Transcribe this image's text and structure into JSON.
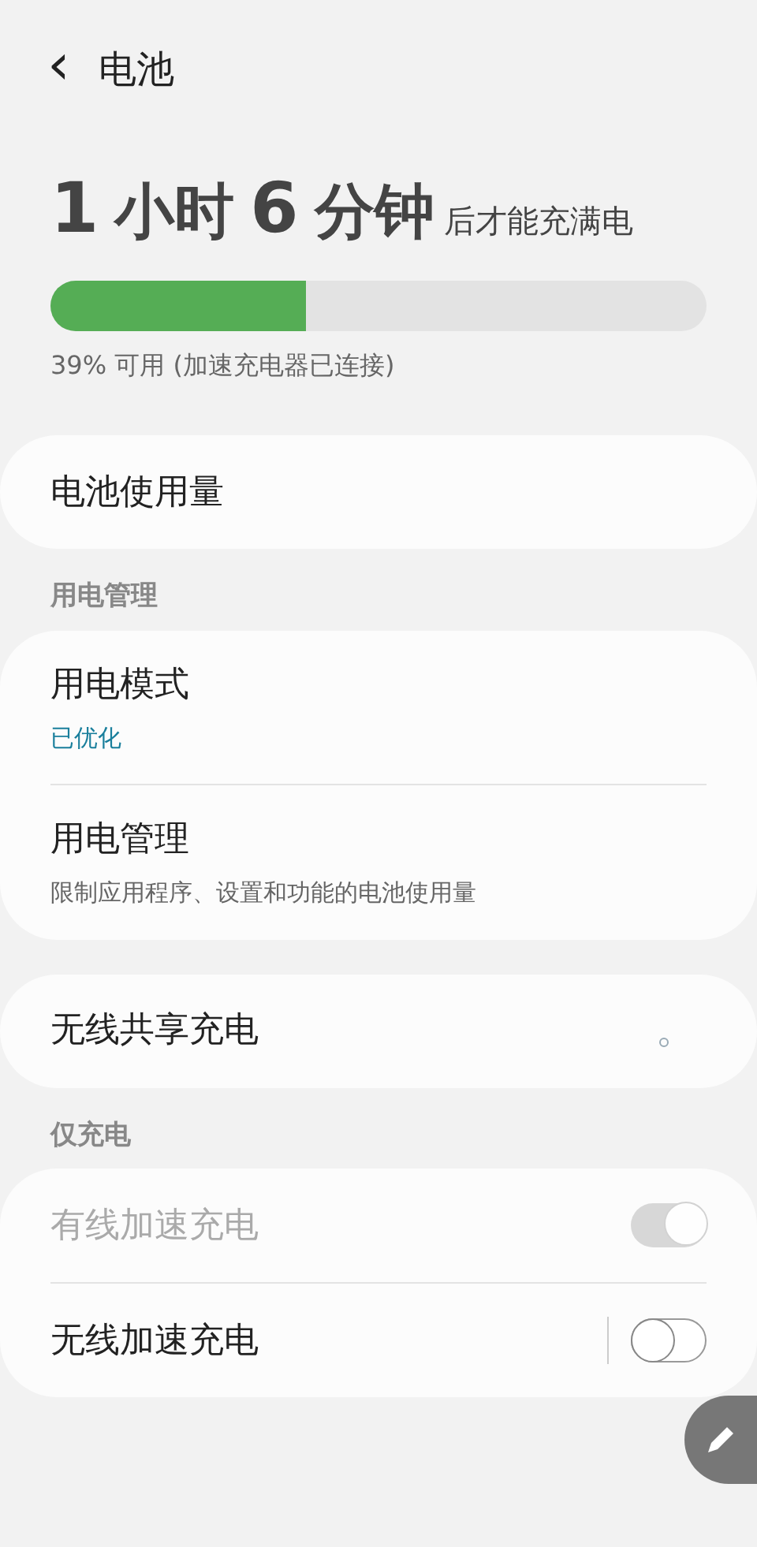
{
  "header": {
    "back_icon": "‹",
    "title": "电池"
  },
  "charge": {
    "time_parts": [
      {
        "kind": "number",
        "text": "1"
      },
      {
        "kind": "unit",
        "text": "小时"
      },
      {
        "kind": "number",
        "text": "6"
      },
      {
        "kind": "unit",
        "text": "分钟"
      }
    ],
    "suffix": "后才能充满电",
    "level": 0.39,
    "note": "39% 可用 (加速充电器已连接)"
  },
  "sections": [
    {
      "items": [
        {
          "kind": "link",
          "title": "电池使用量"
        }
      ]
    },
    {
      "header": "用电管理",
      "items": [
        {
          "kind": "link",
          "title": "用电模式",
          "subtitle": "已优化",
          "accent": true
        },
        {
          "kind": "link",
          "title": "用电管理",
          "subtitle": "限制应用程序、设置和功能的电池使用量",
          "accent": false
        }
      ]
    },
    {
      "items": [
        {
          "kind": "loading",
          "title": "无线共享充电"
        }
      ]
    },
    {
      "header": "仅充电",
      "items": [
        {
          "kind": "switch",
          "title": "有线加速充电",
          "on": true,
          "disabled": true,
          "divider": false
        },
        {
          "kind": "switch",
          "title": "无线加速充电",
          "on": false,
          "disabled": false,
          "divider": true
        }
      ]
    }
  ]
}
